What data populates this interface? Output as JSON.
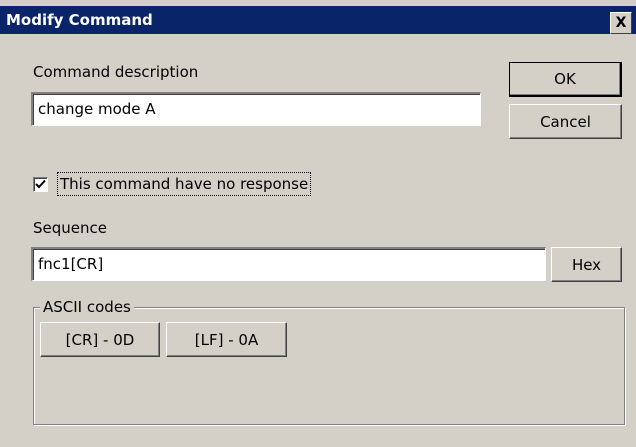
{
  "window": {
    "title": "Modify Command",
    "close_glyph": "X"
  },
  "description": {
    "label": "Command description",
    "value": "change mode A"
  },
  "buttons": {
    "ok": "OK",
    "cancel": "Cancel",
    "hex": "Hex"
  },
  "no_response": {
    "label": "This command have no response",
    "checked": true
  },
  "sequence": {
    "label": "Sequence",
    "value": "fnc1[CR]"
  },
  "ascii_codes": {
    "title": "ASCII codes",
    "items": [
      {
        "label": "[CR] - 0D"
      },
      {
        "label": "[LF] - 0A"
      }
    ]
  },
  "colors": {
    "titlebar": "#0a246a",
    "dialog_face": "#d4d0c8"
  }
}
